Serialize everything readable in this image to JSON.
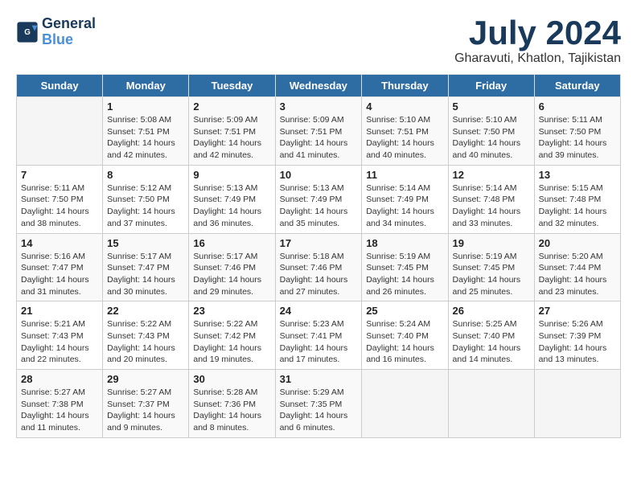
{
  "header": {
    "logo_line1": "General",
    "logo_line2": "Blue",
    "month_title": "July 2024",
    "subtitle": "Gharavuti, Khatlon, Tajikistan"
  },
  "days_of_week": [
    "Sunday",
    "Monday",
    "Tuesday",
    "Wednesday",
    "Thursday",
    "Friday",
    "Saturday"
  ],
  "weeks": [
    [
      {
        "day": "",
        "info": ""
      },
      {
        "day": "1",
        "info": "Sunrise: 5:08 AM\nSunset: 7:51 PM\nDaylight: 14 hours\nand 42 minutes."
      },
      {
        "day": "2",
        "info": "Sunrise: 5:09 AM\nSunset: 7:51 PM\nDaylight: 14 hours\nand 42 minutes."
      },
      {
        "day": "3",
        "info": "Sunrise: 5:09 AM\nSunset: 7:51 PM\nDaylight: 14 hours\nand 41 minutes."
      },
      {
        "day": "4",
        "info": "Sunrise: 5:10 AM\nSunset: 7:51 PM\nDaylight: 14 hours\nand 40 minutes."
      },
      {
        "day": "5",
        "info": "Sunrise: 5:10 AM\nSunset: 7:50 PM\nDaylight: 14 hours\nand 40 minutes."
      },
      {
        "day": "6",
        "info": "Sunrise: 5:11 AM\nSunset: 7:50 PM\nDaylight: 14 hours\nand 39 minutes."
      }
    ],
    [
      {
        "day": "7",
        "info": "Sunrise: 5:11 AM\nSunset: 7:50 PM\nDaylight: 14 hours\nand 38 minutes."
      },
      {
        "day": "8",
        "info": "Sunrise: 5:12 AM\nSunset: 7:50 PM\nDaylight: 14 hours\nand 37 minutes."
      },
      {
        "day": "9",
        "info": "Sunrise: 5:13 AM\nSunset: 7:49 PM\nDaylight: 14 hours\nand 36 minutes."
      },
      {
        "day": "10",
        "info": "Sunrise: 5:13 AM\nSunset: 7:49 PM\nDaylight: 14 hours\nand 35 minutes."
      },
      {
        "day": "11",
        "info": "Sunrise: 5:14 AM\nSunset: 7:49 PM\nDaylight: 14 hours\nand 34 minutes."
      },
      {
        "day": "12",
        "info": "Sunrise: 5:14 AM\nSunset: 7:48 PM\nDaylight: 14 hours\nand 33 minutes."
      },
      {
        "day": "13",
        "info": "Sunrise: 5:15 AM\nSunset: 7:48 PM\nDaylight: 14 hours\nand 32 minutes."
      }
    ],
    [
      {
        "day": "14",
        "info": "Sunrise: 5:16 AM\nSunset: 7:47 PM\nDaylight: 14 hours\nand 31 minutes."
      },
      {
        "day": "15",
        "info": "Sunrise: 5:17 AM\nSunset: 7:47 PM\nDaylight: 14 hours\nand 30 minutes."
      },
      {
        "day": "16",
        "info": "Sunrise: 5:17 AM\nSunset: 7:46 PM\nDaylight: 14 hours\nand 29 minutes."
      },
      {
        "day": "17",
        "info": "Sunrise: 5:18 AM\nSunset: 7:46 PM\nDaylight: 14 hours\nand 27 minutes."
      },
      {
        "day": "18",
        "info": "Sunrise: 5:19 AM\nSunset: 7:45 PM\nDaylight: 14 hours\nand 26 minutes."
      },
      {
        "day": "19",
        "info": "Sunrise: 5:19 AM\nSunset: 7:45 PM\nDaylight: 14 hours\nand 25 minutes."
      },
      {
        "day": "20",
        "info": "Sunrise: 5:20 AM\nSunset: 7:44 PM\nDaylight: 14 hours\nand 23 minutes."
      }
    ],
    [
      {
        "day": "21",
        "info": "Sunrise: 5:21 AM\nSunset: 7:43 PM\nDaylight: 14 hours\nand 22 minutes."
      },
      {
        "day": "22",
        "info": "Sunrise: 5:22 AM\nSunset: 7:43 PM\nDaylight: 14 hours\nand 20 minutes."
      },
      {
        "day": "23",
        "info": "Sunrise: 5:22 AM\nSunset: 7:42 PM\nDaylight: 14 hours\nand 19 minutes."
      },
      {
        "day": "24",
        "info": "Sunrise: 5:23 AM\nSunset: 7:41 PM\nDaylight: 14 hours\nand 17 minutes."
      },
      {
        "day": "25",
        "info": "Sunrise: 5:24 AM\nSunset: 7:40 PM\nDaylight: 14 hours\nand 16 minutes."
      },
      {
        "day": "26",
        "info": "Sunrise: 5:25 AM\nSunset: 7:40 PM\nDaylight: 14 hours\nand 14 minutes."
      },
      {
        "day": "27",
        "info": "Sunrise: 5:26 AM\nSunset: 7:39 PM\nDaylight: 14 hours\nand 13 minutes."
      }
    ],
    [
      {
        "day": "28",
        "info": "Sunrise: 5:27 AM\nSunset: 7:38 PM\nDaylight: 14 hours\nand 11 minutes."
      },
      {
        "day": "29",
        "info": "Sunrise: 5:27 AM\nSunset: 7:37 PM\nDaylight: 14 hours\nand 9 minutes."
      },
      {
        "day": "30",
        "info": "Sunrise: 5:28 AM\nSunset: 7:36 PM\nDaylight: 14 hours\nand 8 minutes."
      },
      {
        "day": "31",
        "info": "Sunrise: 5:29 AM\nSunset: 7:35 PM\nDaylight: 14 hours\nand 6 minutes."
      },
      {
        "day": "",
        "info": ""
      },
      {
        "day": "",
        "info": ""
      },
      {
        "day": "",
        "info": ""
      }
    ]
  ]
}
